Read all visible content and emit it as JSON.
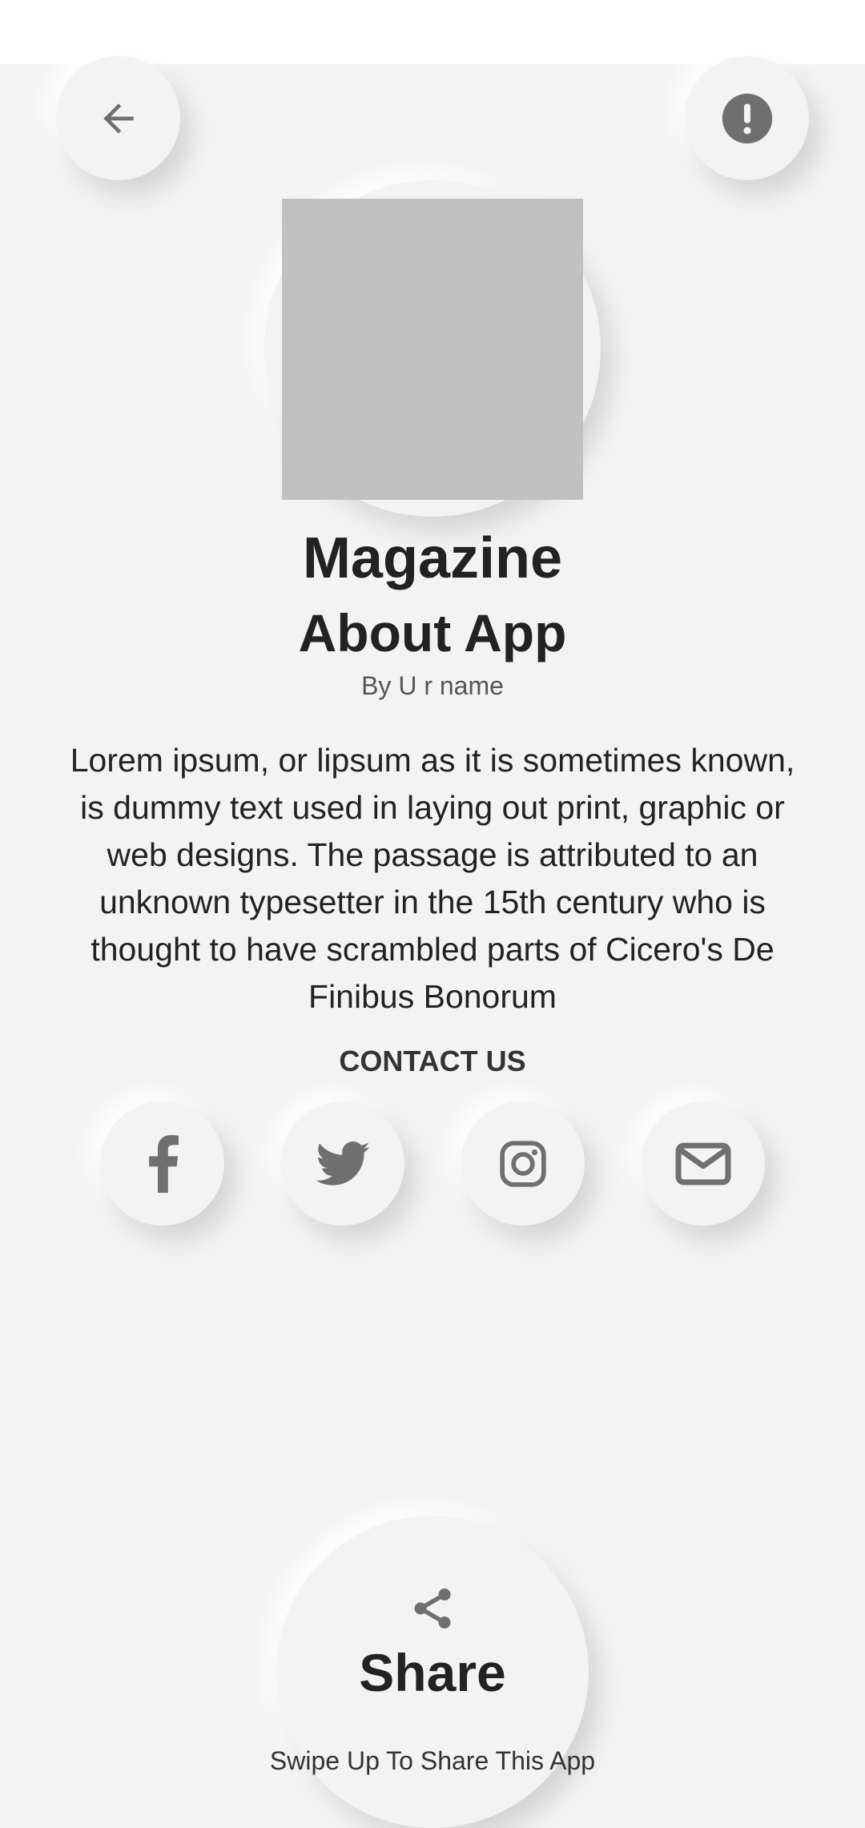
{
  "header": {
    "back_icon": "arrow-left-icon",
    "info_icon": "exclamation-circle-icon"
  },
  "app": {
    "name": "Magazine",
    "section_title": "About App",
    "byline": "By U r name",
    "description": "Lorem ipsum, or lipsum as it is sometimes known, is dummy text used in laying out print, graphic or web designs. The passage is attributed to an unknown typesetter in the 15th century who is thought to have scrambled parts of Cicero's De Finibus Bonorum"
  },
  "contact": {
    "title": "CONTACT US",
    "links": [
      {
        "icon": "facebook-icon"
      },
      {
        "icon": "twitter-icon"
      },
      {
        "icon": "instagram-icon"
      },
      {
        "icon": "envelope-icon"
      }
    ]
  },
  "share": {
    "icon": "share-icon",
    "label": "Share",
    "hint": "Swipe Up To Share This App"
  },
  "colors": {
    "background": "#f3f3f3",
    "icon": "#6f6f6f",
    "text": "#222222",
    "placeholder": "#c1c1c1"
  }
}
